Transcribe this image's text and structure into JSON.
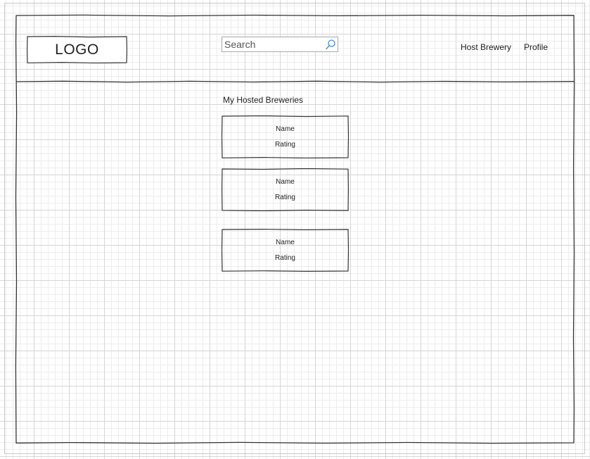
{
  "header": {
    "logo": "LOGO",
    "search": {
      "placeholder": "Search",
      "value": ""
    },
    "nav": {
      "host_brewery": "Host Brewery",
      "profile": "Profile"
    }
  },
  "main": {
    "section_title": "My Hosted Breweries",
    "breweries": [
      {
        "name": "Name",
        "rating": "Rating"
      },
      {
        "name": "Name",
        "rating": "Rating"
      },
      {
        "name": "Name",
        "rating": "Rating"
      }
    ]
  },
  "colors": {
    "sketch_line": "#333333",
    "search_icon": "#3b8ed6",
    "grid": "#d5d5d5"
  },
  "icons": {
    "search": "search-icon"
  }
}
